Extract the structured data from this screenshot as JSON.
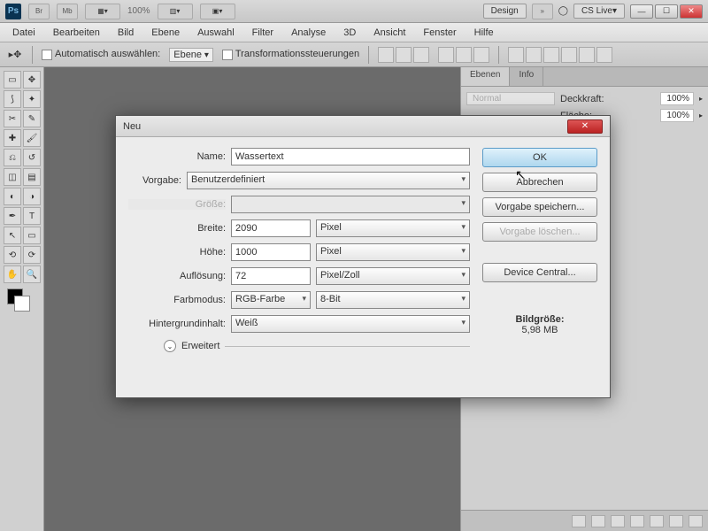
{
  "topbar": {
    "zoom": "100%",
    "design": "Design",
    "cslive": "CS Live▾"
  },
  "menu": [
    "Datei",
    "Bearbeiten",
    "Bild",
    "Ebene",
    "Auswahl",
    "Filter",
    "Analyse",
    "3D",
    "Ansicht",
    "Fenster",
    "Hilfe"
  ],
  "options": {
    "auto_label": "Automatisch auswählen:",
    "auto_sel": "Ebene",
    "transform_label": "Transformationssteuerungen"
  },
  "panels": {
    "tabs": [
      "Ebenen",
      "Info"
    ],
    "blend": "Normal",
    "opacity_label": "Deckkraft:",
    "opacity_val": "100%",
    "fill_label": "Fläche:",
    "fill_val": "100%"
  },
  "dialog": {
    "title": "Neu",
    "name_label": "Name:",
    "name_val": "Wassertext",
    "preset_label": "Vorgabe:",
    "preset_val": "Benutzerdefiniert",
    "size_label": "Größe:",
    "size_val": "",
    "width_label": "Breite:",
    "width_val": "2090",
    "width_unit": "Pixel",
    "height_label": "Höhe:",
    "height_val": "1000",
    "height_unit": "Pixel",
    "res_label": "Auflösung:",
    "res_val": "72",
    "res_unit": "Pixel/Zoll",
    "mode_label": "Farbmodus:",
    "mode_val": "RGB-Farbe",
    "mode_bits": "8-Bit",
    "bg_label": "Hintergrundinhalt:",
    "bg_val": "Weiß",
    "advanced": "Erweitert",
    "ok": "OK",
    "cancel": "Abbrechen",
    "save_preset": "Vorgabe speichern...",
    "del_preset": "Vorgabe löschen...",
    "device_central": "Device Central...",
    "imgsize_label": "Bildgröße:",
    "imgsize_val": "5,98 MB"
  }
}
